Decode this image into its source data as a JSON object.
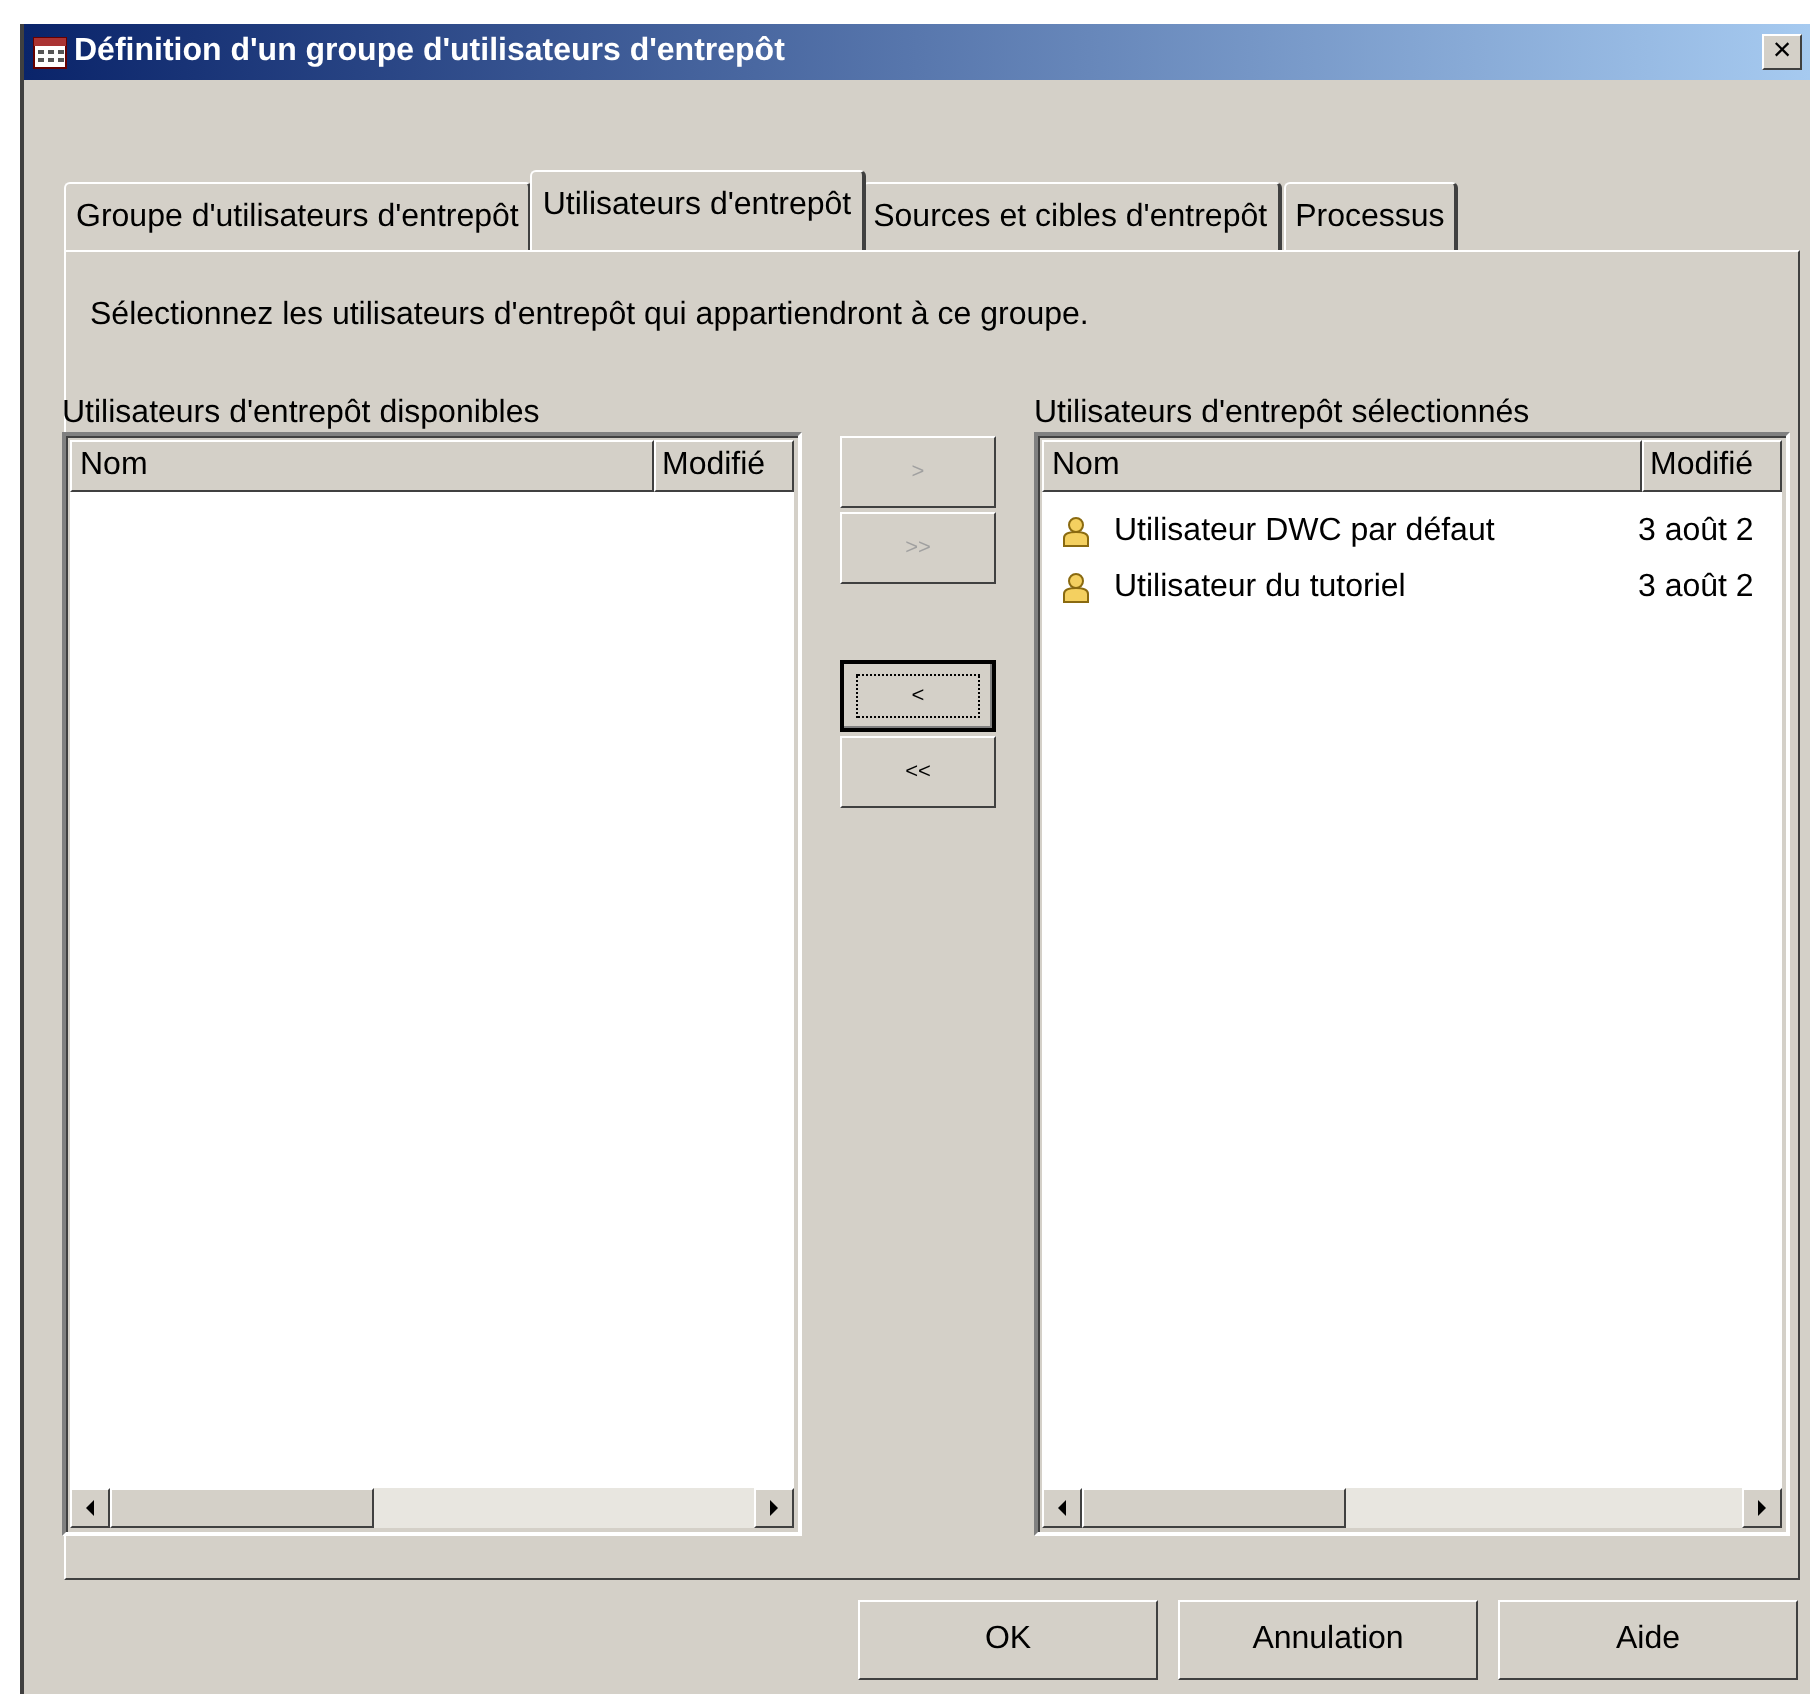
{
  "window": {
    "title": "Définition d'un groupe d'utilisateurs d'entrepôt",
    "close": "×"
  },
  "tabs": [
    {
      "label": "Groupe d'utilisateurs d'entrepôt",
      "selected": false
    },
    {
      "label": "Utilisateurs d'entrepôt",
      "selected": true
    },
    {
      "label": "Sources et cibles d'entrepôt",
      "selected": false
    },
    {
      "label": "Processus",
      "selected": false
    }
  ],
  "instruction": "Sélectionnez les utilisateurs d'entrepôt qui appartiendront à ce groupe.",
  "available": {
    "label": "Utilisateurs d'entrepôt disponibles",
    "columns": [
      "Nom",
      "Modifié"
    ]
  },
  "move_buttons": [
    {
      "label": ">",
      "disabled": true,
      "focused": false
    },
    {
      "label": ">>",
      "disabled": true,
      "focused": false
    },
    {
      "label": "<",
      "disabled": false,
      "focused": true
    },
    {
      "label": "<<",
      "disabled": false,
      "focused": false
    }
  ],
  "selected": {
    "label": "Utilisateurs d'entrepôt sélectionnés",
    "columns": [
      "Nom",
      "Modifié"
    ],
    "rows": [
      {
        "name": "Utilisateur DWC par défaut",
        "modified": "3 août 2"
      },
      {
        "name": "Utilisateur du tutoriel",
        "modified": "3 août 2"
      }
    ]
  },
  "buttons": [
    "OK",
    "Annulation",
    "Aide"
  ]
}
